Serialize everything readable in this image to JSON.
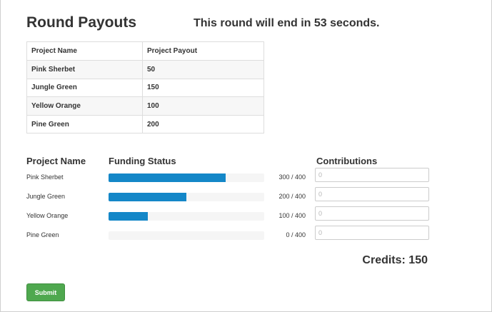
{
  "header": {
    "title": "Round Payouts",
    "timer_text": "This round will end in 53 seconds."
  },
  "payout_table": {
    "columns": [
      "Project Name",
      "Project Payout"
    ],
    "rows": [
      {
        "name": "Pink Sherbet",
        "payout": "50"
      },
      {
        "name": "Jungle Green",
        "payout": "150"
      },
      {
        "name": "Yellow Orange",
        "payout": "100"
      },
      {
        "name": "Pine Green",
        "payout": "200"
      }
    ]
  },
  "funding": {
    "headers": {
      "name": "Project Name",
      "status": "Funding Status",
      "contributions": "Contributions"
    },
    "bar_color": "#1487c8",
    "projects": [
      {
        "name": "Pink Sherbet",
        "funded": 300,
        "goal": 400,
        "amount_text": "300 / 400",
        "contribution_placeholder": "0"
      },
      {
        "name": "Jungle Green",
        "funded": 200,
        "goal": 400,
        "amount_text": "200 / 400",
        "contribution_placeholder": "0"
      },
      {
        "name": "Yellow Orange",
        "funded": 100,
        "goal": 400,
        "amount_text": "100 / 400",
        "contribution_placeholder": "0"
      },
      {
        "name": "Pine Green",
        "funded": 0,
        "goal": 400,
        "amount_text": "0 / 400",
        "contribution_placeholder": "0"
      }
    ]
  },
  "credits_text": "Credits: 150",
  "submit_label": "Submit",
  "submit_color": "#4fa84f"
}
